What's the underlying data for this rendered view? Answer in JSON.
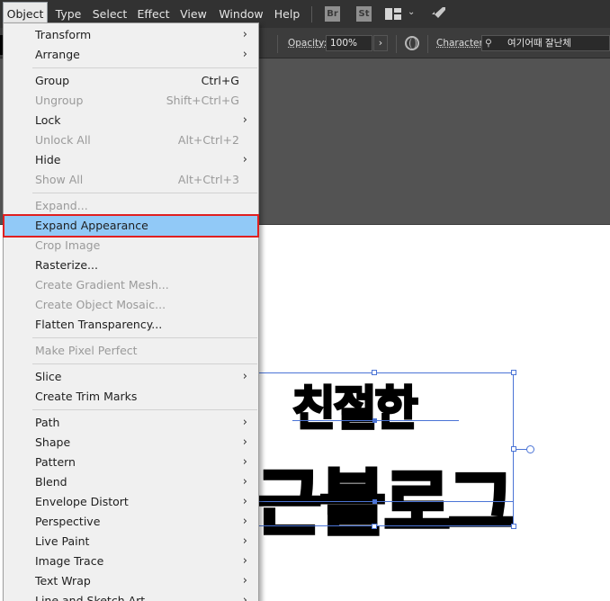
{
  "menubar": {
    "items": [
      "Object",
      "Type",
      "Select",
      "Effect",
      "View",
      "Window",
      "Help"
    ],
    "bridge_icon_text": "Br",
    "stock_icon_text": "St"
  },
  "controlbar": {
    "opacity_label": "Opacity:",
    "opacity_value": "100%",
    "character_label": "Character:",
    "font_value": "여기어때 잘난체"
  },
  "object_menu": {
    "items": [
      {
        "label": "Transform",
        "shortcut": "",
        "submenu": true,
        "disabled": false
      },
      {
        "label": "Arrange",
        "shortcut": "",
        "submenu": true,
        "disabled": false
      },
      {
        "label": "Group",
        "shortcut": "Ctrl+G",
        "submenu": false,
        "disabled": false
      },
      {
        "label": "Ungroup",
        "shortcut": "Shift+Ctrl+G",
        "submenu": false,
        "disabled": true
      },
      {
        "label": "Lock",
        "shortcut": "",
        "submenu": true,
        "disabled": false
      },
      {
        "label": "Unlock All",
        "shortcut": "Alt+Ctrl+2",
        "submenu": false,
        "disabled": true
      },
      {
        "label": "Hide",
        "shortcut": "",
        "submenu": true,
        "disabled": false
      },
      {
        "label": "Show All",
        "shortcut": "Alt+Ctrl+3",
        "submenu": false,
        "disabled": true
      },
      {
        "label": "Expand...",
        "shortcut": "",
        "submenu": false,
        "disabled": true
      },
      {
        "label": "Expand Appearance",
        "shortcut": "",
        "submenu": false,
        "disabled": false,
        "highlighted": true
      },
      {
        "label": "Crop Image",
        "shortcut": "",
        "submenu": false,
        "disabled": true
      },
      {
        "label": "Rasterize...",
        "shortcut": "",
        "submenu": false,
        "disabled": false
      },
      {
        "label": "Create Gradient Mesh...",
        "shortcut": "",
        "submenu": false,
        "disabled": true
      },
      {
        "label": "Create Object Mosaic...",
        "shortcut": "",
        "submenu": false,
        "disabled": true
      },
      {
        "label": "Flatten Transparency...",
        "shortcut": "",
        "submenu": false,
        "disabled": false
      },
      {
        "label": "Make Pixel Perfect",
        "shortcut": "",
        "submenu": false,
        "disabled": true
      },
      {
        "label": "Slice",
        "shortcut": "",
        "submenu": true,
        "disabled": false
      },
      {
        "label": "Create Trim Marks",
        "shortcut": "",
        "submenu": false,
        "disabled": false
      },
      {
        "label": "Path",
        "shortcut": "",
        "submenu": true,
        "disabled": false
      },
      {
        "label": "Shape",
        "shortcut": "",
        "submenu": true,
        "disabled": false
      },
      {
        "label": "Pattern",
        "shortcut": "",
        "submenu": true,
        "disabled": false
      },
      {
        "label": "Blend",
        "shortcut": "",
        "submenu": true,
        "disabled": false
      },
      {
        "label": "Envelope Distort",
        "shortcut": "",
        "submenu": true,
        "disabled": false
      },
      {
        "label": "Perspective",
        "shortcut": "",
        "submenu": true,
        "disabled": false
      },
      {
        "label": "Live Paint",
        "shortcut": "",
        "submenu": true,
        "disabled": false
      },
      {
        "label": "Image Trace",
        "shortcut": "",
        "submenu": true,
        "disabled": false
      },
      {
        "label": "Text Wrap",
        "shortcut": "",
        "submenu": true,
        "disabled": false
      },
      {
        "label": "Line and Sketch Art",
        "shortcut": "",
        "submenu": true,
        "disabled": false
      }
    ]
  },
  "artwork": {
    "line1": "친절한",
    "line2": "당근블로그"
  },
  "colors": {
    "highlight": "#91c9f7",
    "highlight_outline": "#e02020",
    "selection": "#4b74d6"
  }
}
